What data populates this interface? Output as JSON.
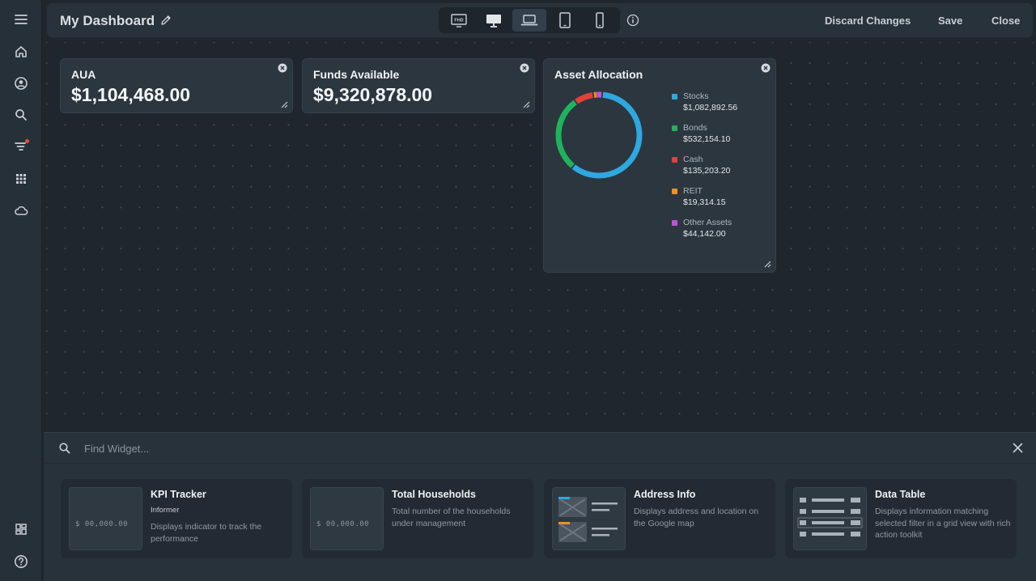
{
  "header": {
    "title": "My Dashboard",
    "device_modes": [
      {
        "name": "fhd",
        "label": "FHD"
      },
      {
        "name": "desktop",
        "label": "Desktop"
      },
      {
        "name": "laptop",
        "label": "Laptop"
      },
      {
        "name": "tablet",
        "label": "Tablet"
      },
      {
        "name": "mobile",
        "label": "Mobile"
      }
    ],
    "active_device": "laptop",
    "discard_label": "Discard Changes",
    "save_label": "Save",
    "close_label": "Close"
  },
  "sidebar": {
    "top_icons": [
      "menu-icon",
      "home-icon",
      "profile-icon",
      "search-icon",
      "filter-icon",
      "apps-grid-icon",
      "cloud-icon"
    ],
    "bottom_icons": [
      "widgets-icon",
      "help-icon"
    ],
    "filter_badge_color": "#e74c3c"
  },
  "widgets": {
    "aua": {
      "title": "AUA",
      "value": "$1,104,468.00"
    },
    "funds": {
      "title": "Funds Available",
      "value": "$9,320,878.00"
    },
    "allocation": {
      "title": "Asset Allocation",
      "items": [
        {
          "name": "Stocks",
          "value": "$1,082,892.56",
          "color": "#2ea8e0"
        },
        {
          "name": "Bonds",
          "value": "$532,154.10",
          "color": "#1fb35c"
        },
        {
          "name": "Cash",
          "value": "$135,203.20",
          "color": "#e0413a"
        },
        {
          "name": "REIT",
          "value": "$19,314.15",
          "color": "#f0921d"
        },
        {
          "name": "Other Assets",
          "value": "$44,142.00",
          "color": "#c152d6"
        }
      ]
    }
  },
  "chart_data": {
    "type": "pie",
    "title": "Asset Allocation",
    "categories": [
      "Stocks",
      "Bonds",
      "Cash",
      "REIT",
      "Other Assets"
    ],
    "values": [
      1082892.56,
      532154.1,
      135203.2,
      19314.15,
      44142.0
    ],
    "legend_position": "right",
    "colors": [
      "#2ea8e0",
      "#1fb35c",
      "#e0413a",
      "#f0921d",
      "#c152d6"
    ]
  },
  "widget_panel": {
    "search_placeholder": "Find Widget...",
    "cards": [
      {
        "title": "KPI Tracker",
        "subtitle": "Informer",
        "description": "Displays indicator to track the performance",
        "thumb_text": "$ 00,000.00"
      },
      {
        "title": "Total Households",
        "subtitle": "",
        "description": "Total number of the households under management",
        "thumb_text": "$ 00,000.00"
      },
      {
        "title": "Address Info",
        "subtitle": "",
        "description": "Displays address and location on the Google map",
        "thumb_text": ""
      },
      {
        "title": "Data Table",
        "subtitle": "",
        "description": "Displays information matching selected filter in a grid view with rich action toolkit",
        "thumb_text": ""
      }
    ]
  }
}
